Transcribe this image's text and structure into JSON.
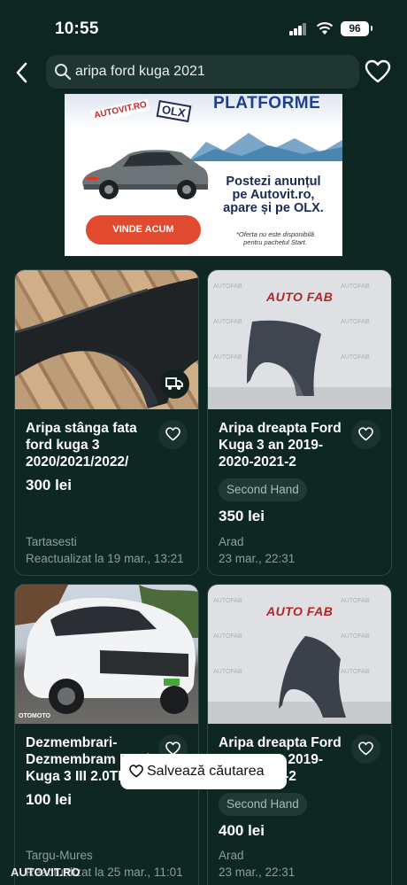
{
  "status_bar": {
    "time": "10:55",
    "battery": "96"
  },
  "header": {
    "search_query": "aripa ford kuga 2021"
  },
  "banner": {
    "headline": "PLATFORME",
    "autovit_logo": "AUTOVIT.RO",
    "olx_logo": "OLX",
    "message_line1": "Postezi anunțul",
    "message_line2": "pe Autovit.ro,",
    "message_line3": "apare și pe OLX.",
    "note_line1": "*Oferta nu este disponibilă",
    "note_line2": "pentru pachetul Start.",
    "cta": "VINDE ACUM"
  },
  "listings": [
    {
      "title": "Aripa stânga fata ford kuga 3 2020/2021/2022/",
      "price": "300 lei",
      "condition": "",
      "location": "Tartasesti",
      "date": "Reactualizat la 19 mar., 13:21",
      "delivery_available": true,
      "image_watermark": ""
    },
    {
      "title": "Aripa dreapta Ford Kuga 3 an 2019-2020-2021-2",
      "price": "350 lei",
      "condition": "Second Hand",
      "location": "Arad",
      "date": "23 mar., 22:31",
      "delivery_available": false,
      "image_watermark": "AUTO FAB"
    },
    {
      "title": "Dezmembrari-Dezmembram Ford Kuga 3 III 2.0TDCI",
      "price": "100 lei",
      "condition": "",
      "location": "Targu-Mures",
      "date": "Reactualizat la 25 mar., 11:01",
      "delivery_available": false,
      "image_watermark": "OTOMOTO"
    },
    {
      "title": "Aripa dreapta Ford Kuga 3 an 2019-2020-2021-2",
      "price": "400 lei",
      "condition": "Second Hand",
      "location": "Arad",
      "date": "23 mar., 22:31",
      "delivery_available": false,
      "image_watermark": "AUTO FAB"
    }
  ],
  "save_search_label": "Salvează căutarea",
  "watermark": "AUTOVIT.RO"
}
